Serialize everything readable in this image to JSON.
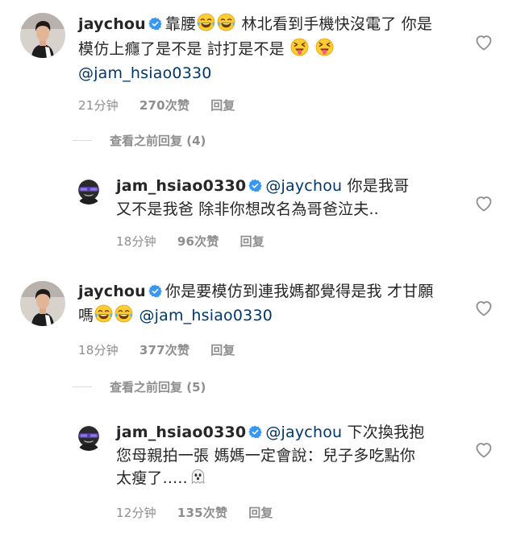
{
  "comments": [
    {
      "username": "jaychou",
      "text1": "靠腰",
      "text2": " 林北看到手機快沒電了 你是模仿上癮了是不是 討打是不是",
      "emoji_a": "tears-of-joy",
      "emoji_b": "squinting-tongue",
      "mention": "@jam_hsiao0330",
      "time": "21分钟",
      "likes": "270次赞",
      "reply": "回复"
    },
    {
      "username": "jam_hsiao0330",
      "mention": "@jaychou",
      "text1": " 你是我哥 又不是我爸 除非你想改名為哥爸泣夫..",
      "time": "18分钟",
      "likes": "96次赞",
      "reply": "回复"
    },
    {
      "username": "jaychou",
      "text1": "你是要模仿到連我媽都覺得是我 才甘願嗎",
      "emoji": "tears-of-joy",
      "mention": "@jam_hsiao0330",
      "time": "18分钟",
      "likes": "377次赞",
      "reply": "回复"
    },
    {
      "username": "jam_hsiao0330",
      "mention": "@jaychou",
      "text1": " 下次換我抱您母親拍一張 媽媽一定會說：兒子多吃點你太瘦了.....",
      "emoji": "ghost",
      "time": "12分钟",
      "likes": "135次赞",
      "reply": "回复"
    }
  ],
  "view_replies": [
    {
      "label": "查看之前回复 (4)"
    },
    {
      "label": "查看之前回复 (5)"
    }
  ],
  "icons": {
    "verified": "verified-badge-icon",
    "like": "heart-outline-icon"
  },
  "colors": {
    "text": "#262626",
    "meta": "#8e8e8e",
    "verified": "#3897f0",
    "mention": "#00376b",
    "divider": "#dbdbdb"
  }
}
